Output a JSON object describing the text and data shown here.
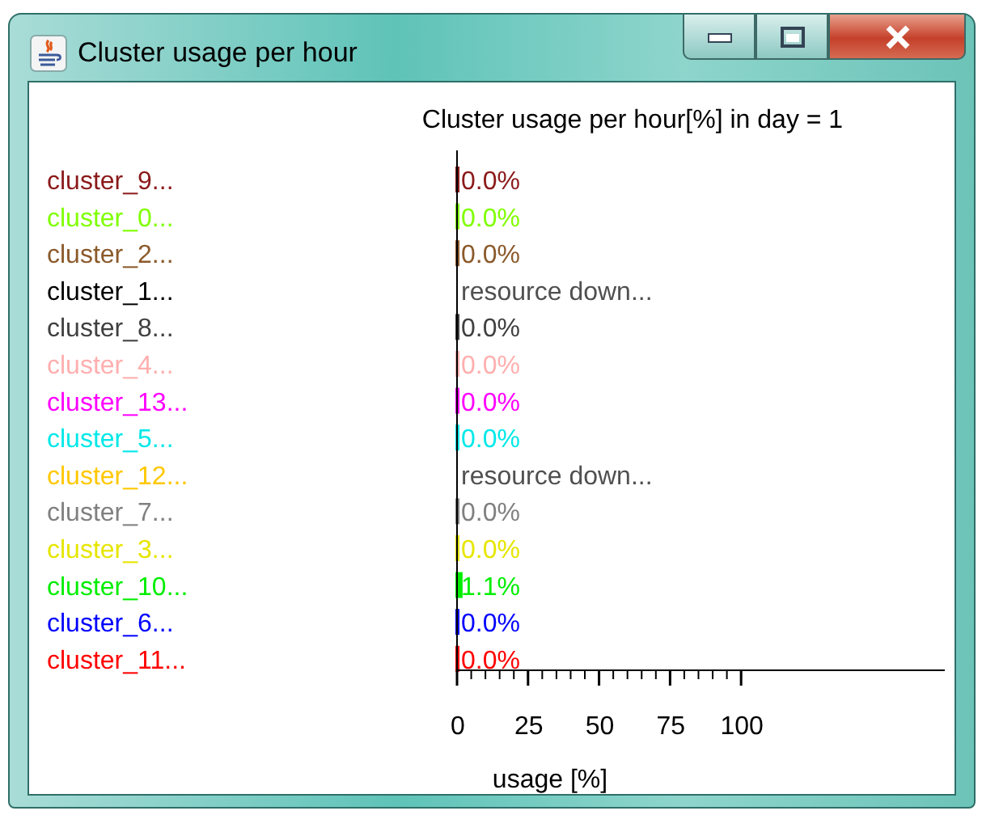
{
  "window": {
    "title": "Cluster usage per hour"
  },
  "chart": {
    "chart_data": {
      "type": "bar",
      "orientation": "horizontal",
      "title": "Cluster usage per hour[%] in day = 1",
      "xlabel": "usage [%]",
      "series": [
        {
          "name": "cluster_9...",
          "color": "#8b1a1a",
          "values": [
            0
          ]
        },
        {
          "name": "cluster_0...",
          "color": "#80ff00",
          "values": [
            0
          ]
        },
        {
          "name": "cluster_2...",
          "color": "#8b5a2b",
          "values": [
            0
          ]
        },
        {
          "name": "cluster_1...",
          "color": "#000000",
          "values": [
            null
          ]
        },
        {
          "name": "cluster_8...",
          "color": "#404040",
          "values": [
            0
          ]
        },
        {
          "name": "cluster_4...",
          "color": "#ffafaf",
          "values": [
            0
          ]
        },
        {
          "name": "cluster_13...",
          "color": "#ff00ff",
          "values": [
            0
          ]
        },
        {
          "name": "cluster_5...",
          "color": "#00e8e8",
          "values": [
            0
          ]
        },
        {
          "name": "cluster_12...",
          "color": "#ffc800",
          "values": [
            null
          ]
        },
        {
          "name": "cluster_7...",
          "color": "#808080",
          "values": [
            0
          ]
        },
        {
          "name": "cluster_3...",
          "color": "#e6e600",
          "values": [
            0
          ]
        },
        {
          "name": "cluster_10...",
          "color": "#00ee00",
          "values": [
            1.1
          ]
        },
        {
          "name": "cluster_6...",
          "color": "#0000ff",
          "values": [
            0
          ]
        },
        {
          "name": "cluster_11...",
          "color": "#ff0000",
          "values": [
            0
          ]
        }
      ],
      "value_labels": [
        "0.0%",
        "0.0%",
        "0.0%",
        "resource down...",
        "0.0%",
        "0.0%",
        "0.0%",
        "0.0%",
        "resource down...",
        "0.0%",
        "0.0%",
        "1.1%",
        "0.0%",
        "0.0%"
      ],
      "xlim": [
        0,
        172
      ],
      "xticks": [
        {
          "value": 0,
          "label": "0"
        },
        {
          "value": 25,
          "label": "25"
        },
        {
          "value": 50,
          "label": "50"
        },
        {
          "value": 75,
          "label": "75"
        },
        {
          "value": 100,
          "label": "100"
        }
      ]
    }
  }
}
